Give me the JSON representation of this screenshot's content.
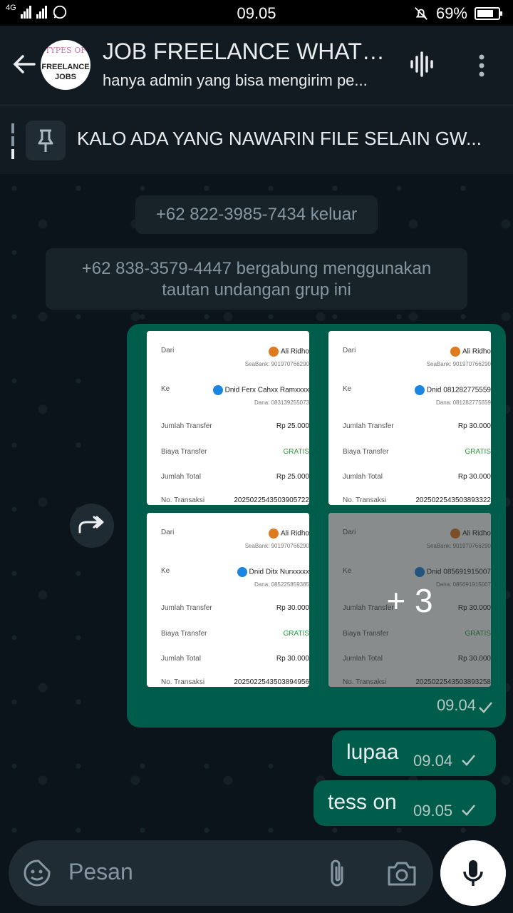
{
  "status_bar": {
    "network": "4G",
    "time": "09.05",
    "battery": "69%"
  },
  "header": {
    "title": "JOB FREELANCE WHATS...",
    "subtitle": "hanya admin yang bisa mengirim pe...",
    "avatar_line1": "TYPES OF",
    "avatar_line2": "FREELANCE",
    "avatar_line3": "JOBS"
  },
  "pinned": {
    "text": "KALO ADA YANG NAWARIN FILE SELAIN GW..."
  },
  "system_messages": {
    "left": "+62 822-3985-7434 keluar",
    "joined_line1": "+62 838-3579-4447 bergabung menggunakan",
    "joined_line2": "tautan undangan grup ini"
  },
  "image_message": {
    "time": "09.04",
    "more_count": "+ 3",
    "labels": {
      "from": "Dari",
      "to": "Ke",
      "amount": "Jumlah Transfer",
      "fee": "Biaya Transfer",
      "total": "Jumlah Total",
      "tx": "No. Transaksi",
      "sender": "Ali Ridho",
      "seabank": "SeaBank: 901970766290",
      "free": "GRATIS"
    },
    "thumbs": [
      {
        "recipient": "Dnid Ferx Cahxx Ramxxxx",
        "dana": "Dana: 083139255073",
        "amount": "Rp 25.000",
        "total": "Rp 25.000",
        "tx": "2025022543503905722"
      },
      {
        "recipient": "Dnid 081282775559",
        "dana": "Dana: 081282775559",
        "amount": "Rp 30.000",
        "total": "Rp 30.000",
        "tx": "2025022543503893322"
      },
      {
        "recipient": "Dnid Ditx Nurxxxxx",
        "dana": "Dana: 085225859385",
        "amount": "Rp 30.000",
        "total": "Rp 30.000",
        "tx": "2025022543503894956"
      },
      {
        "recipient": "Dnid 085691915007",
        "dana": "Dana: 085691915007",
        "amount": "Rp 30.000",
        "total": "Rp 30.000",
        "tx": "2025022543503893258"
      }
    ]
  },
  "messages": [
    {
      "text": "lupaa",
      "time": "09.04"
    },
    {
      "text": "tess on",
      "time": "09.05"
    }
  ],
  "input": {
    "placeholder": "Pesan"
  },
  "colors": {
    "outgoing_bubble": "#005c4b",
    "background": "#0b141a",
    "header": "#111b21"
  }
}
